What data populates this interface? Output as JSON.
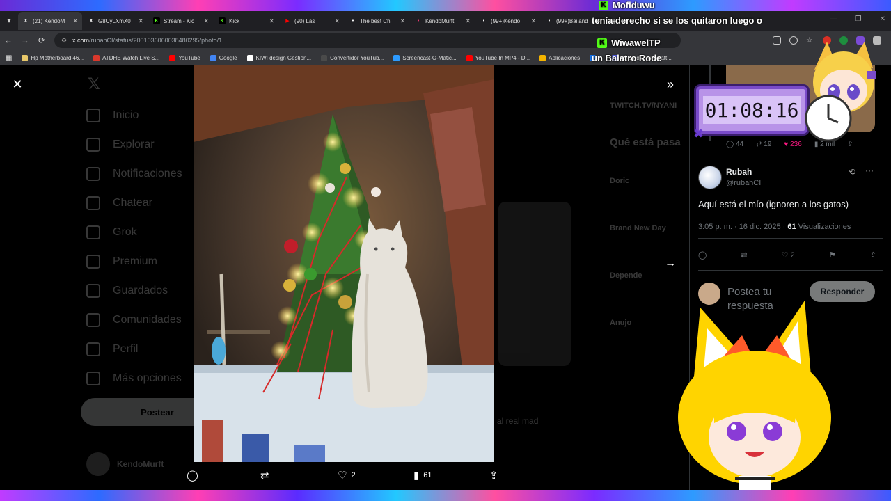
{
  "browser": {
    "tabs": [
      {
        "title": "(21) KendoM",
        "icon": "x-logo-icon",
        "color": "#ffffff",
        "active": true
      },
      {
        "title": "G8UyLXmX0",
        "icon": "x-logo-icon",
        "color": "#ffffff",
        "active": false
      },
      {
        "title": "Stream - Kic",
        "icon": "kick-logo-icon",
        "color": "#53fc18",
        "active": false
      },
      {
        "title": "Kick",
        "icon": "kick-logo-icon",
        "color": "#53fc18",
        "active": false
      },
      {
        "title": "(90) Las",
        "icon": "youtube-icon",
        "color": "#ff0000",
        "active": false
      },
      {
        "title": "The best Ch",
        "icon": "shield-icon",
        "color": "#ffffff",
        "active": false
      },
      {
        "title": "KendoMurft",
        "icon": "app-icon",
        "color": "#ff3b7a",
        "active": false
      },
      {
        "title": "(99+)Kendo",
        "icon": "tiktok-icon",
        "color": "#ffffff",
        "active": false
      },
      {
        "title": "(99+)Bailand",
        "icon": "tiktok-icon",
        "color": "#ffffff",
        "active": false
      }
    ],
    "url_host": "x.com",
    "url_path": "/rubahCI/status/2001036060038480295/photo/1",
    "bookmarks": [
      {
        "label": "Hp Motherboard 46...",
        "color": "#e8c86a"
      },
      {
        "label": "ATDHE Watch Live S...",
        "color": "#d9382c"
      },
      {
        "label": "YouTube",
        "color": "#ff0000"
      },
      {
        "label": "Google",
        "color": "#4285f4"
      },
      {
        "label": "KIWI design Gestión...",
        "color": "#ffffff"
      },
      {
        "label": "Convertidor YouTub...",
        "color": "#4a4a4a"
      },
      {
        "label": "Screencast-O-Matic...",
        "color": "#2d9bff"
      },
      {
        "label": "YouTube In MP4 - D...",
        "color": "#ff0000"
      },
      {
        "label": "Aplicaciones",
        "color": "#f4b400"
      },
      {
        "label": "F",
        "color": "#1877f2"
      },
      {
        "label": "(2) sv de minecraft...",
        "color": "#5865f2"
      }
    ]
  },
  "x": {
    "sidebar": [
      "Inicio",
      "Explorar",
      "Notificaciones",
      "Chatear",
      "Grok",
      "Premium",
      "Guardados",
      "Comunidades",
      "Perfil",
      "Más opciones"
    ],
    "post_button": "Postear",
    "account_name": "KendoMurft",
    "right_col": {
      "top_label": "TWITCH.TV/NYANI",
      "whats_happening": "Qué está pasa",
      "trends": [
        "Doric",
        "Brand New Day",
        "Depende",
        "Anujo"
      ]
    },
    "middle_footer": "al real mad"
  },
  "photo_actions": {
    "likes": "2",
    "views": "61"
  },
  "prev_tweet_stats": {
    "replies": "44",
    "reposts": "19",
    "likes": "236",
    "views": "2 mil"
  },
  "tweet": {
    "name": "Rubah",
    "handle": "@rubahCI",
    "text": "Aquí está el mío (ignoren a los gatos)",
    "time": "3:05 p. m. · 16 dic. 2025 ·",
    "views_count": "61",
    "views_label": "Visualizaciones",
    "likes": "2",
    "reply_placeholder": "Postea tu respuesta",
    "reply_button": "Responder"
  },
  "overlay": {
    "timer": "01:08:16",
    "chat": [
      {
        "user": "Mofiduwu",
        "message": "tenía derecho si se los quitaron luego o"
      },
      {
        "user": "WiwawelTP",
        "message": "un Balatro Rode"
      }
    ],
    "accent": "#b893e8"
  }
}
